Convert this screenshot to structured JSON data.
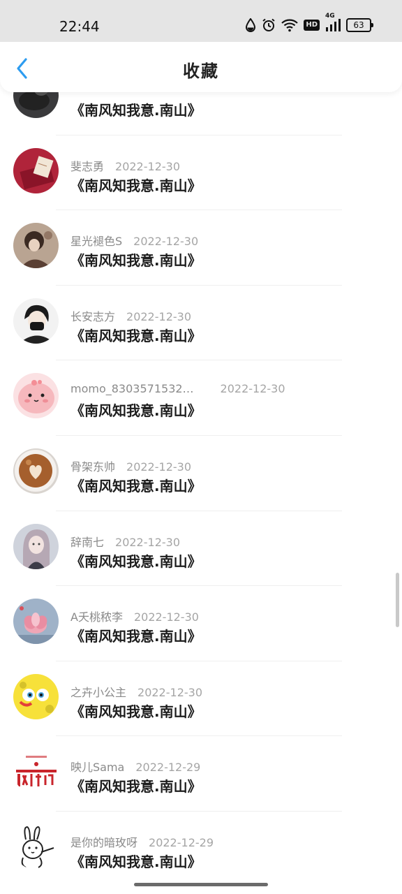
{
  "status_bar": {
    "time": "22:44",
    "hd_label": "HD",
    "signal_label": "4G",
    "battery": "63",
    "icons": [
      "drop-icon",
      "alarm-icon",
      "wifi-icon",
      "hd-icon",
      "signal-icon",
      "battery-icon"
    ]
  },
  "header": {
    "title": "收藏",
    "back_icon": "chevron-left-icon",
    "accent_color": "#2d9cf0"
  },
  "items": [
    {
      "username": "",
      "date": "",
      "title": "《南风知我意.南山》",
      "avatar": "dark-photo"
    },
    {
      "username": "斐志勇",
      "date": "2022-12-30",
      "title": "《南风知我意.南山》",
      "avatar": "red-card"
    },
    {
      "username": "星光褪色S",
      "date": "2022-12-30",
      "title": "《南风知我意.南山》",
      "avatar": "anime-girl-dark"
    },
    {
      "username": "长安志方",
      "date": "2022-12-30",
      "title": "《南风知我意.南山》",
      "avatar": "masked-boy"
    },
    {
      "username": "momo_8303571532…",
      "date": "2022-12-30",
      "title": "《南风知我意.南山》",
      "avatar": "pink-creature"
    },
    {
      "username": "骨架东帅",
      "date": "2022-12-30",
      "title": "《南风知我意.南山》",
      "avatar": "latte-art"
    },
    {
      "username": "辞南七",
      "date": "2022-12-30",
      "title": "《南风知我意.南山》",
      "avatar": "anime-girl-light"
    },
    {
      "username": "A夭桃秾李",
      "date": "2022-12-30",
      "title": "《南风知我意.南山》",
      "avatar": "pink-lotus"
    },
    {
      "username": "之卉小公主",
      "date": "2022-12-30",
      "title": "《南风知我意.南山》",
      "avatar": "yellow-sponge"
    },
    {
      "username": "映儿Sama",
      "date": "2022-12-29",
      "title": "《南风知我意.南山》",
      "avatar": "red-logo"
    },
    {
      "username": "是你的暗玫呀",
      "date": "2022-12-29",
      "title": "《南风知我意.南山》",
      "avatar": "bunny-sketch"
    }
  ]
}
